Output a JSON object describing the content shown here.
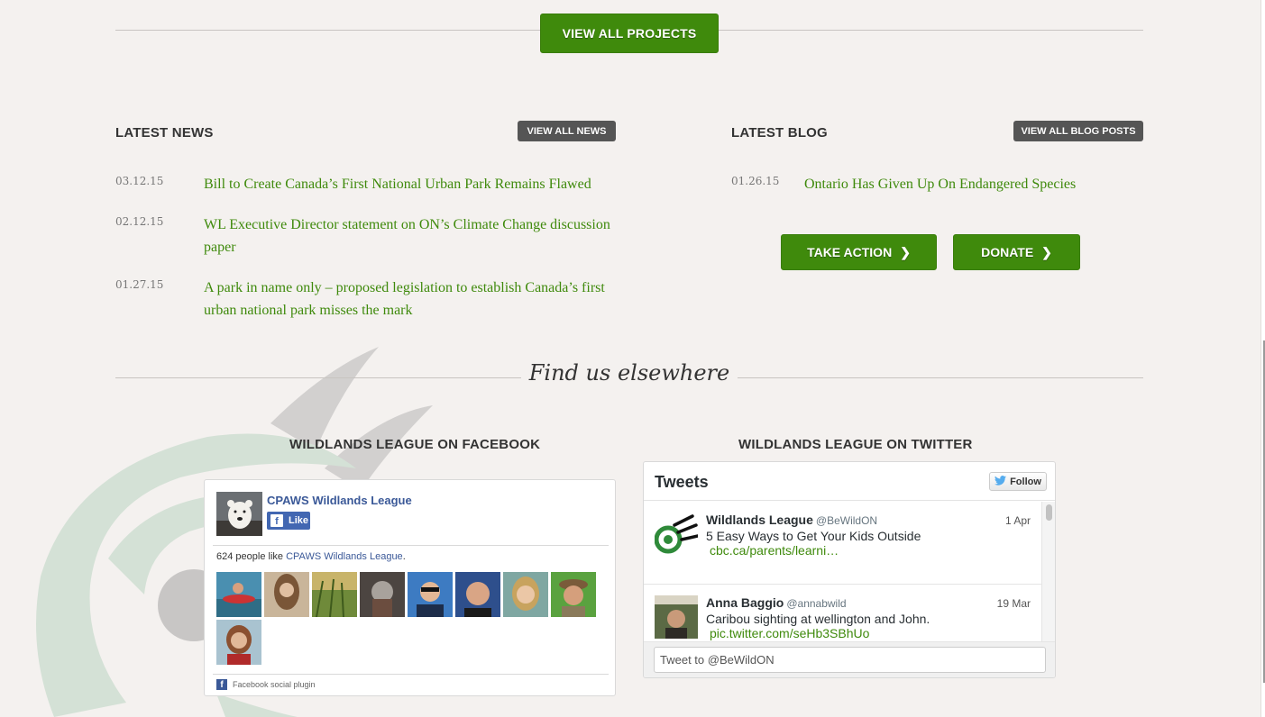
{
  "projects": {
    "view_all_label": "VIEW ALL PROJECTS"
  },
  "news": {
    "title": "LATEST NEWS",
    "view_all_label": "VIEW ALL NEWS",
    "items": [
      {
        "date": "03.12.15",
        "title": "Bill to Create Canada’s First National Urban Park Remains Flawed"
      },
      {
        "date": "02.12.15",
        "title": "WL Executive Director statement on ON’s Climate Change discussion paper"
      },
      {
        "date": "01.27.15",
        "title": "A park in name only – proposed legislation to establish Canada’s first urban national park misses the mark"
      }
    ]
  },
  "blog": {
    "title": "LATEST BLOG",
    "view_all_label": "VIEW ALL BLOG POSTS",
    "items": [
      {
        "date": "01.26.15",
        "title": "Ontario Has Given Up On Endangered Species"
      }
    ]
  },
  "actions": {
    "take_action_label": "TAKE ACTION",
    "donate_label": "DONATE"
  },
  "elsewhere": {
    "title": "Find us elsewhere"
  },
  "facebook": {
    "title": "WILDLANDS LEAGUE ON FACEBOOK",
    "page_name": "CPAWS Wildlands League",
    "like_label": "Like",
    "count_prefix": "624 people like ",
    "count_link": "CPAWS Wildlands League",
    "count_suffix": ".",
    "footer": "Facebook social plugin"
  },
  "twitter": {
    "title": "WILDLANDS LEAGUE ON TWITTER",
    "header": "Tweets",
    "follow_label": "Follow",
    "tweets": [
      {
        "name": "Wildlands League",
        "handle": "@BeWildON",
        "date": "1 Apr",
        "text": "5 Easy Ways to Get Your Kids Outside",
        "link": "cbc.ca/parents/learni…"
      },
      {
        "name": "Anna Baggio",
        "handle": "@annabwild",
        "date": "19 Mar",
        "text": "Caribou sighting at wellington and John.",
        "link": "pic.twitter.com/seHb3SBhUo"
      }
    ],
    "input_placeholder": "Tweet to @BeWildON"
  },
  "colors": {
    "accent_green": "#3f8a0c",
    "dark_button": "#555555",
    "facebook_blue": "#3b5998",
    "background": "#f4f1ef"
  }
}
